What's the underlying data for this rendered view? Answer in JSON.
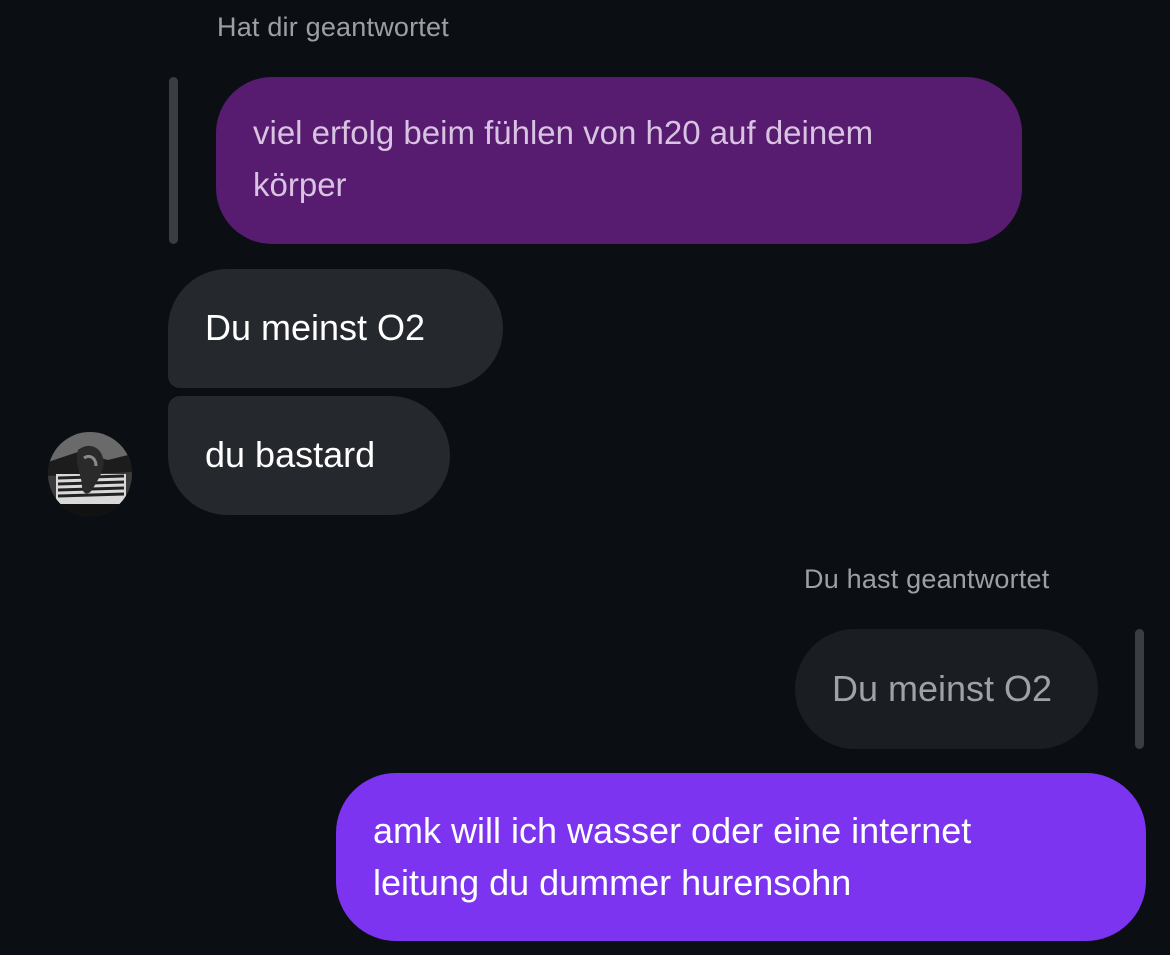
{
  "thread": {
    "incoming_reply": {
      "caption": "Hat dir geantwortet",
      "quoted_text_line1": "viel erfolg beim fühlen von h20 auf deinem",
      "quoted_text_line2": "körper"
    },
    "incoming_messages": [
      {
        "text": "Du meinst O2"
      },
      {
        "text": "du bastard"
      }
    ],
    "contact_avatar": "contact-avatar",
    "outgoing_reply": {
      "caption": "Du hast geantwortet",
      "quoted_text": "Du meinst O2",
      "message_line1": "amk will ich wasser oder eine internet",
      "message_line2": "leitung du dummer hurensohn"
    }
  },
  "colors": {
    "background": "#0b0f13",
    "quoted_incoming_bubble": "#571b6f",
    "incoming_bubble": "#25282d",
    "quoted_outgoing_bubble": "#1a1d21",
    "outgoing_bubble": "#7c34f0",
    "caption_text": "#9aa0a6"
  }
}
